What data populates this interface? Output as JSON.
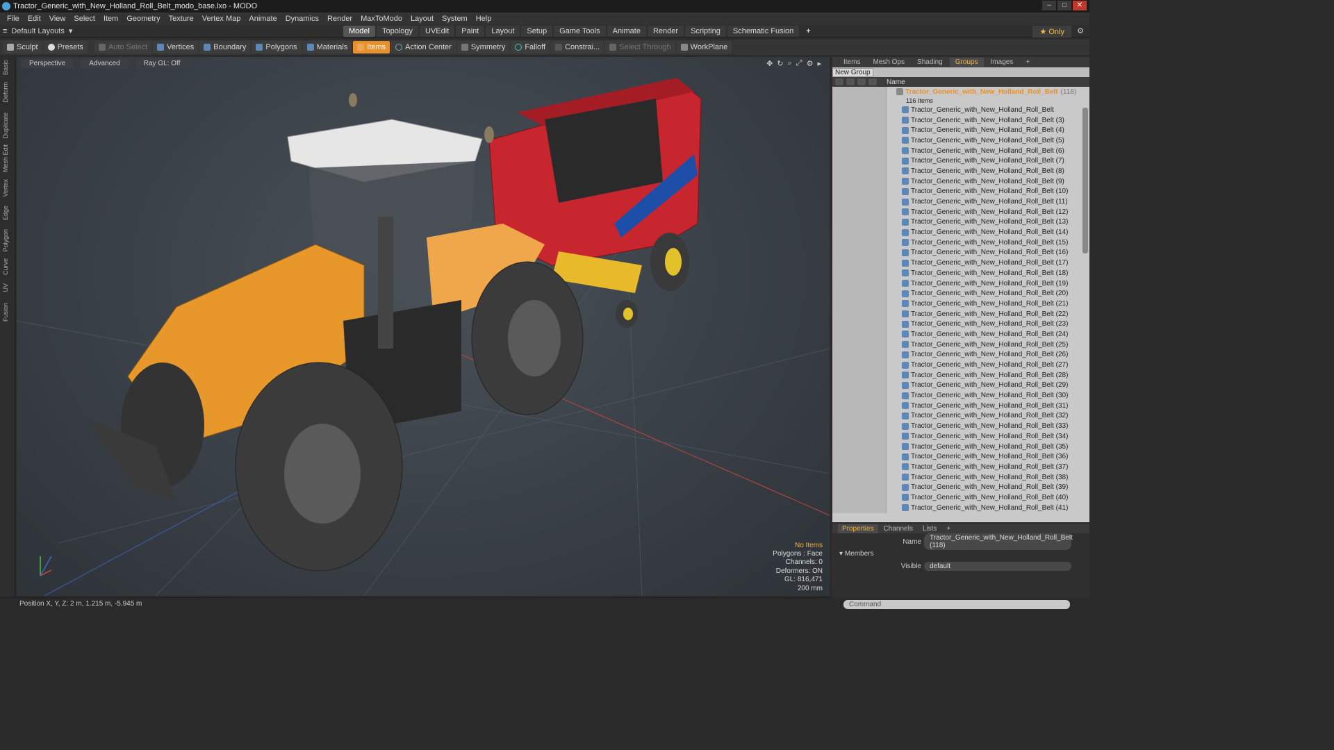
{
  "window": {
    "title": "Tractor_Generic_with_New_Holland_Roll_Belt_modo_base.lxo - MODO",
    "controls": [
      "–",
      "□",
      "✕"
    ]
  },
  "menu": [
    "File",
    "Edit",
    "View",
    "Select",
    "Item",
    "Geometry",
    "Texture",
    "Vertex Map",
    "Animate",
    "Dynamics",
    "Render",
    "MaxToModo",
    "Layout",
    "System",
    "Help"
  ],
  "layoutbar": {
    "layout_selector": "Default Layouts",
    "tabs": [
      "Model",
      "Topology",
      "UVEdit",
      "Paint",
      "Layout",
      "Setup",
      "Game Tools",
      "Animate",
      "Render",
      "Scripting",
      "Schematic Fusion"
    ],
    "active_tab": "Model",
    "only_label": "Only"
  },
  "toolbar": {
    "sculpt": "Sculpt",
    "presets": "Presets",
    "auto_select": "Auto Select",
    "vertices": "Vertices",
    "boundary": "Boundary",
    "polygons": "Polygons",
    "materials": "Materials",
    "items": "Items",
    "action_center": "Action Center",
    "symmetry": "Symmetry",
    "falloff": "Falloff",
    "constraints": "Constrai...",
    "select_through": "Select Through",
    "workplane": "WorkPlane"
  },
  "left_tabs": [
    "Basic",
    "Deform",
    "Duplicate",
    "Mesh Edit",
    "Vertex",
    "Edge",
    "Polygon",
    "Curve",
    "UV",
    "Fusion"
  ],
  "viewport": {
    "view_mode": "Perspective",
    "shading": "Advanced",
    "raygl": "Ray GL: Off",
    "info": {
      "selection": "No Items",
      "polygons": "Polygons : Face",
      "channels": "Channels: 0",
      "deformers": "Deformers: ON",
      "gl": "GL: 816,471",
      "scale": "200 mm"
    }
  },
  "status": {
    "position": "Position X, Y, Z:  2 m, 1.215 m, -5.945 m"
  },
  "groups_panel": {
    "tabs": [
      "Items",
      "Mesh Ops",
      "Shading",
      "Groups",
      "Images",
      "+"
    ],
    "active_tab": "Groups",
    "new_group": "New Group",
    "col_name": "Name",
    "group_name": "Tractor_Generic_with_New_Holland_Roll_Belt",
    "group_count": "(118)",
    "items_count": "116 Items",
    "items": [
      "Tractor_Generic_with_New_Holland_Roll_Belt",
      "Tractor_Generic_with_New_Holland_Roll_Belt (3)",
      "Tractor_Generic_with_New_Holland_Roll_Belt (4)",
      "Tractor_Generic_with_New_Holland_Roll_Belt (5)",
      "Tractor_Generic_with_New_Holland_Roll_Belt (6)",
      "Tractor_Generic_with_New_Holland_Roll_Belt (7)",
      "Tractor_Generic_with_New_Holland_Roll_Belt (8)",
      "Tractor_Generic_with_New_Holland_Roll_Belt (9)",
      "Tractor_Generic_with_New_Holland_Roll_Belt (10)",
      "Tractor_Generic_with_New_Holland_Roll_Belt (11)",
      "Tractor_Generic_with_New_Holland_Roll_Belt (12)",
      "Tractor_Generic_with_New_Holland_Roll_Belt (13)",
      "Tractor_Generic_with_New_Holland_Roll_Belt (14)",
      "Tractor_Generic_with_New_Holland_Roll_Belt (15)",
      "Tractor_Generic_with_New_Holland_Roll_Belt (16)",
      "Tractor_Generic_with_New_Holland_Roll_Belt (17)",
      "Tractor_Generic_with_New_Holland_Roll_Belt (18)",
      "Tractor_Generic_with_New_Holland_Roll_Belt (19)",
      "Tractor_Generic_with_New_Holland_Roll_Belt (20)",
      "Tractor_Generic_with_New_Holland_Roll_Belt (21)",
      "Tractor_Generic_with_New_Holland_Roll_Belt (22)",
      "Tractor_Generic_with_New_Holland_Roll_Belt (23)",
      "Tractor_Generic_with_New_Holland_Roll_Belt (24)",
      "Tractor_Generic_with_New_Holland_Roll_Belt (25)",
      "Tractor_Generic_with_New_Holland_Roll_Belt (26)",
      "Tractor_Generic_with_New_Holland_Roll_Belt (27)",
      "Tractor_Generic_with_New_Holland_Roll_Belt (28)",
      "Tractor_Generic_with_New_Holland_Roll_Belt (29)",
      "Tractor_Generic_with_New_Holland_Roll_Belt (30)",
      "Tractor_Generic_with_New_Holland_Roll_Belt (31)",
      "Tractor_Generic_with_New_Holland_Roll_Belt (32)",
      "Tractor_Generic_with_New_Holland_Roll_Belt (33)",
      "Tractor_Generic_with_New_Holland_Roll_Belt (34)",
      "Tractor_Generic_with_New_Holland_Roll_Belt (35)",
      "Tractor_Generic_with_New_Holland_Roll_Belt (36)",
      "Tractor_Generic_with_New_Holland_Roll_Belt (37)",
      "Tractor_Generic_with_New_Holland_Roll_Belt (38)",
      "Tractor_Generic_with_New_Holland_Roll_Belt (39)",
      "Tractor_Generic_with_New_Holland_Roll_Belt (40)",
      "Tractor_Generic_with_New_Holland_Roll_Belt (41)"
    ]
  },
  "properties_panel": {
    "tabs": [
      "Properties",
      "Channels",
      "Lists",
      "+"
    ],
    "active_tab": "Properties",
    "name_label": "Name",
    "name_value": "Tractor_Generic_with_New_Holland_Roll_Belt (118)",
    "members_label": "Members",
    "visible_label": "Visible",
    "visible_value": "default"
  },
  "command": {
    "placeholder": "Command"
  },
  "colors": {
    "accent": "#e8912c",
    "highlight": "#f3b23a",
    "tractor_body": "#e8982a",
    "baler_red": "#c8262e",
    "baler_blue": "#1d4fa8"
  }
}
